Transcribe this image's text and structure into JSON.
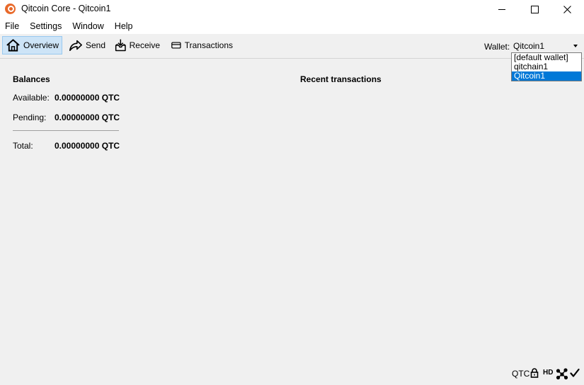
{
  "window": {
    "title": "Qitcoin Core - Qitcoin1",
    "app_icon": "qitcoin-logo-icon",
    "accent": "#e8692a"
  },
  "menu": [
    "File",
    "Settings",
    "Window",
    "Help"
  ],
  "toolbar": {
    "overview": "Overview",
    "send": "Send",
    "receive": "Receive",
    "transactions": "Transactions",
    "active": "Overview",
    "active_bg": "#cde4f7"
  },
  "wallet": {
    "label": "Wallet:",
    "selected": "Qitcoin1",
    "options": [
      "[default wallet]",
      "qitchain1",
      "Qitcoin1"
    ],
    "highlight_color": "#0078d7"
  },
  "balances": {
    "title": "Balances",
    "available_label": "Available:",
    "available_value": "0.00000000 QTC",
    "pending_label": "Pending:",
    "pending_value": "0.00000000 QTC",
    "total_label": "Total:",
    "total_value": "0.00000000 QTC"
  },
  "recent": {
    "title": "Recent transactions"
  },
  "status": {
    "unit": "QTC",
    "hd": "HD",
    "icons": [
      "lock-icon",
      "hd-icon",
      "network-icon",
      "synced-check-icon"
    ]
  }
}
